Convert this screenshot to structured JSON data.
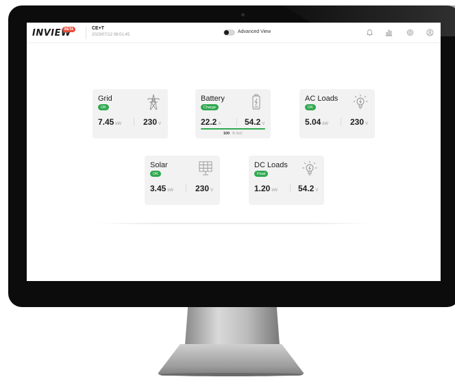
{
  "header": {
    "logo": "INVIEW",
    "beta_badge": "BETA",
    "site_name": "CE+T",
    "timestamp": "2023/07/12 08:01:45",
    "advanced_view_label": "Advanced View",
    "advanced_view_on": false
  },
  "icons": {
    "notifications": "bell-icon",
    "charts": "bar-chart-icon",
    "settings": "gear-icon",
    "account": "user-icon"
  },
  "colors": {
    "status_green": "#2fa84f",
    "beta_red": "#e74c3c",
    "card_bg": "#f2f2f3"
  },
  "cards": {
    "grid": {
      "title": "Grid",
      "status": "OK",
      "icon": "power-tower-icon",
      "value1": "7.45",
      "unit1": "kW",
      "value2": "230",
      "unit2": "V"
    },
    "battery": {
      "title": "Battery",
      "status": "Charge",
      "icon": "battery-icon",
      "value1": "22.2",
      "unit1": "A",
      "value2": "54.2",
      "unit2": "V",
      "soc_value": "100",
      "soc_unit": "% SoC",
      "soc_fraction": 1.0
    },
    "ac_loads": {
      "title": "AC Loads",
      "status": "OK",
      "icon": "lightbulb-icon",
      "value1": "5.04",
      "unit1": "kW",
      "value2": "230",
      "unit2": "V"
    },
    "solar": {
      "title": "Solar",
      "status": "OK",
      "icon": "solar-panel-icon",
      "value1": "3.45",
      "unit1": "kW",
      "value2": "230",
      "unit2": "V"
    },
    "dc_loads": {
      "title": "DC Loads",
      "status": "Float",
      "icon": "lightbulb-icon",
      "value1": "1.20",
      "unit1": "kW",
      "value2": "54.2",
      "unit2": "V"
    }
  }
}
